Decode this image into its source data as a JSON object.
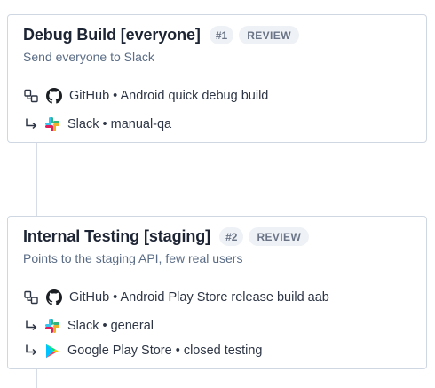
{
  "pipeline": {
    "steps": [
      {
        "title": "Debug Build [everyone]",
        "number": "#1",
        "status": "REVIEW",
        "description": "Send everyone to Slack",
        "source": {
          "icon": "github-icon",
          "service": "GitHub",
          "detail": "Android quick debug build"
        },
        "destinations": [
          {
            "icon": "slack-icon",
            "service": "Slack",
            "detail": "manual-qa"
          }
        ]
      },
      {
        "title": "Internal Testing [staging]",
        "number": "#2",
        "status": "REVIEW",
        "description": "Points to the staging API, few real users",
        "source": {
          "icon": "github-icon",
          "service": "GitHub",
          "detail": "Android Play Store release build aab"
        },
        "destinations": [
          {
            "icon": "slack-icon",
            "service": "Slack",
            "detail": "general"
          },
          {
            "icon": "google-play-icon",
            "service": "Google Play Store",
            "detail": "closed testing"
          }
        ]
      }
    ],
    "separator": "•"
  },
  "colors": {
    "card_border": "#cfd7e2",
    "title": "#1d2433",
    "subtitle": "#5a6c85",
    "badge_bg": "#eef1f5",
    "badge_text": "#6a7486",
    "connector": "#d6dde7"
  }
}
